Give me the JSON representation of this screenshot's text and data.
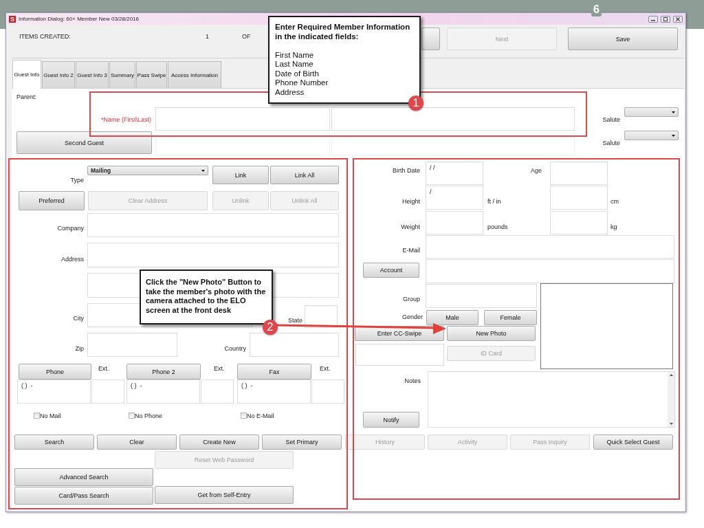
{
  "slide": {
    "number": "6"
  },
  "window": {
    "icon_letter": "S",
    "title": "Information Dialog: 60+ Member New 03/28/2016"
  },
  "header": {
    "items_created_label": "ITEMS CREATED:",
    "count": "1",
    "of_label": "OF",
    "buttons": [
      {
        "label": "Next",
        "disabled": true
      },
      {
        "label": "Save",
        "disabled": false
      }
    ]
  },
  "tabs": [
    {
      "label": "Guest Info",
      "selected": true
    },
    {
      "label": "Guest Info 2",
      "selected": false
    },
    {
      "label": "Guest Info 3",
      "selected": false
    },
    {
      "label": "Summary",
      "selected": false
    },
    {
      "label": "Pass Swipe",
      "selected": false
    },
    {
      "label": "Access Information",
      "selected": false
    }
  ],
  "guest": {
    "parent_label": "Parent:",
    "name_label": "*Name (First\\Last)",
    "second_guest_button": "Second Guest",
    "salute_labels": [
      "Salute",
      "Salute"
    ]
  },
  "address": {
    "type_label": "Type",
    "type_value": "Mailing",
    "buttons": [
      {
        "label": "Link",
        "disabled": false
      },
      {
        "label": "Link All",
        "disabled": false
      },
      {
        "label": "Preferred",
        "disabled": false
      },
      {
        "label": "Clear Address",
        "disabled": true
      },
      {
        "label": "Unlink",
        "disabled": true
      },
      {
        "label": "Unlink All",
        "disabled": true
      }
    ],
    "company_label": "Company",
    "address_label": "Address",
    "city_label": "City",
    "state_label": "State",
    "zip_label": "Zip",
    "country_label": "Country"
  },
  "phones": [
    {
      "button": "Phone",
      "ext_label": "Ext.",
      "value": "( )  -"
    },
    {
      "button": "Phone 2",
      "ext_label": "Ext.",
      "value": "( )  -"
    },
    {
      "button": "Fax",
      "ext_label": "Ext.",
      "value": "( )  -"
    }
  ],
  "opt_outs": [
    {
      "label": "No Mail",
      "checked": false
    },
    {
      "label": "No Phone",
      "checked": false
    },
    {
      "label": "No E-Mail",
      "checked": false
    }
  ],
  "details": {
    "birth_date_label": "Birth Date",
    "birth_date_value": "/ /",
    "age_label": "Age",
    "height_label": "Height",
    "height_value": "/",
    "height_unit": "ft / in",
    "height_metric_unit": "cm",
    "weight_label": "Weight",
    "weight_unit": "pounds",
    "weight_metric_unit": "kg",
    "email_label": "E-Mail",
    "account_button": "Account",
    "group_label": "Group",
    "gender_label": "Gender",
    "gender_buttons": [
      "Male",
      "Female"
    ],
    "card_buttons": [
      {
        "label": "Enter CC-Swipe",
        "disabled": false
      },
      {
        "label": "New Photo",
        "disabled": false
      },
      {
        "label": "ID Card",
        "disabled": true
      }
    ],
    "notes_label": "Notes",
    "notify_button": "Notify"
  },
  "actions": [
    {
      "label": "Search",
      "disabled": false
    },
    {
      "label": "Clear",
      "disabled": false
    },
    {
      "label": "Create New",
      "disabled": false
    },
    {
      "label": "Set Primary",
      "disabled": false
    },
    {
      "label": "History",
      "disabled": true
    },
    {
      "label": "Activity",
      "disabled": true
    },
    {
      "label": "Pass Inquiry",
      "disabled": true
    },
    {
      "label": "Quick Select Guest",
      "disabled": false
    }
  ],
  "extra_actions": [
    {
      "label": "Reset Web Password",
      "disabled": true
    },
    {
      "label": "Advanced Search",
      "disabled": false
    },
    {
      "label": "Card/Pass Search",
      "disabled": false
    },
    {
      "label": "Get from Self-Entry",
      "disabled": false
    }
  ],
  "callouts": [
    {
      "number": "1",
      "title": "Enter Required Member Information in the indicated fields:",
      "lines": [
        "First Name",
        "Last Name",
        "Date of Birth",
        "Phone Number",
        "Address"
      ]
    },
    {
      "number": "2",
      "text": "Click the \"New Photo\" Button to take the member's photo with the camera attached to the ELO screen at the front desk"
    }
  ]
}
